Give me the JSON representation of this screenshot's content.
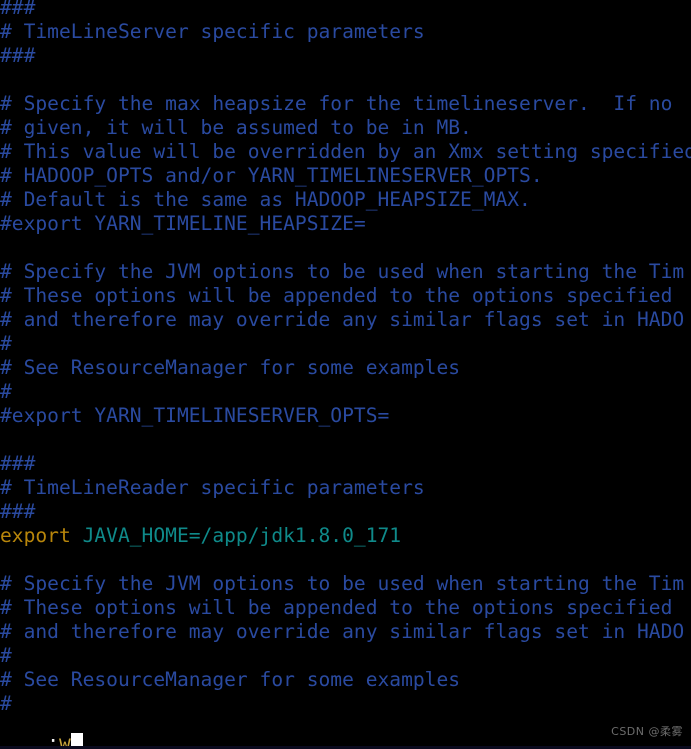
{
  "editor": {
    "name": "vim",
    "mode": "command",
    "background_color": "#000000",
    "comment_color": "#2a4aa0",
    "keyword_color": "#b8860b",
    "value_color": "#0f8a8a",
    "cursor_color": "#ffffff",
    "lines": [
      {
        "id": "l01",
        "segments": [
          {
            "text": "###",
            "style": "comment"
          }
        ]
      },
      {
        "id": "l02",
        "segments": [
          {
            "text": "# TimeLineServer specific parameters",
            "style": "comment"
          }
        ]
      },
      {
        "id": "l03",
        "segments": [
          {
            "text": "###",
            "style": "comment"
          }
        ]
      },
      {
        "id": "l04",
        "segments": [
          {
            "text": "",
            "style": "plain"
          }
        ]
      },
      {
        "id": "l05",
        "segments": [
          {
            "text": "# Specify the max heapsize for the timelineserver.  If no",
            "style": "comment"
          }
        ]
      },
      {
        "id": "l06",
        "segments": [
          {
            "text": "# given, it will be assumed to be in MB.",
            "style": "comment"
          }
        ]
      },
      {
        "id": "l07",
        "segments": [
          {
            "text": "# This value will be overridden by an Xmx setting specified",
            "style": "comment"
          }
        ]
      },
      {
        "id": "l08",
        "segments": [
          {
            "text": "# HADOOP_OPTS and/or YARN_TIMELINESERVER_OPTS.",
            "style": "comment"
          }
        ]
      },
      {
        "id": "l09",
        "segments": [
          {
            "text": "# Default is the same as HADOOP_HEAPSIZE_MAX.",
            "style": "comment"
          }
        ]
      },
      {
        "id": "l10",
        "segments": [
          {
            "text": "#export YARN_TIMELINE_HEAPSIZE=",
            "style": "comment"
          }
        ]
      },
      {
        "id": "l11",
        "segments": [
          {
            "text": "",
            "style": "plain"
          }
        ]
      },
      {
        "id": "l12",
        "segments": [
          {
            "text": "# Specify the JVM options to be used when starting the Tim",
            "style": "comment"
          }
        ]
      },
      {
        "id": "l13",
        "segments": [
          {
            "text": "# These options will be appended to the options specified",
            "style": "comment"
          }
        ]
      },
      {
        "id": "l14",
        "segments": [
          {
            "text": "# and therefore may override any similar flags set in HADO",
            "style": "comment"
          }
        ]
      },
      {
        "id": "l15",
        "segments": [
          {
            "text": "#",
            "style": "comment"
          }
        ]
      },
      {
        "id": "l16",
        "segments": [
          {
            "text": "# See ResourceManager for some examples",
            "style": "comment"
          }
        ]
      },
      {
        "id": "l17",
        "segments": [
          {
            "text": "#",
            "style": "comment"
          }
        ]
      },
      {
        "id": "l18",
        "segments": [
          {
            "text": "#export YARN_TIMELINESERVER_OPTS=",
            "style": "comment"
          }
        ]
      },
      {
        "id": "l19",
        "segments": [
          {
            "text": "",
            "style": "plain"
          }
        ]
      },
      {
        "id": "l20",
        "segments": [
          {
            "text": "###",
            "style": "comment"
          }
        ]
      },
      {
        "id": "l21",
        "segments": [
          {
            "text": "# TimeLineReader specific parameters",
            "style": "comment"
          }
        ]
      },
      {
        "id": "l22",
        "segments": [
          {
            "text": "###",
            "style": "comment"
          }
        ]
      },
      {
        "id": "l23",
        "segments": [
          {
            "text": "export ",
            "style": "keyword"
          },
          {
            "text": "JAVA_HOME=/app/jdk1.8.0_171",
            "style": "value"
          }
        ]
      },
      {
        "id": "l24",
        "segments": [
          {
            "text": "",
            "style": "plain"
          }
        ]
      },
      {
        "id": "l25",
        "segments": [
          {
            "text": "# Specify the JVM options to be used when starting the Tim",
            "style": "comment"
          }
        ]
      },
      {
        "id": "l26",
        "segments": [
          {
            "text": "# These options will be appended to the options specified",
            "style": "comment"
          }
        ]
      },
      {
        "id": "l27",
        "segments": [
          {
            "text": "# and therefore may override any similar flags set in HADO",
            "style": "comment"
          }
        ]
      },
      {
        "id": "l28",
        "segments": [
          {
            "text": "#",
            "style": "comment"
          }
        ]
      },
      {
        "id": "l29",
        "segments": [
          {
            "text": "# See ResourceManager for some examples",
            "style": "comment"
          }
        ]
      },
      {
        "id": "l30",
        "segments": [
          {
            "text": "#",
            "style": "comment"
          }
        ]
      }
    ],
    "command_line": {
      "prompt": ":",
      "command": "wq",
      "cursor_visible": true
    }
  },
  "watermark": {
    "text": "CSDN @柔雾"
  }
}
